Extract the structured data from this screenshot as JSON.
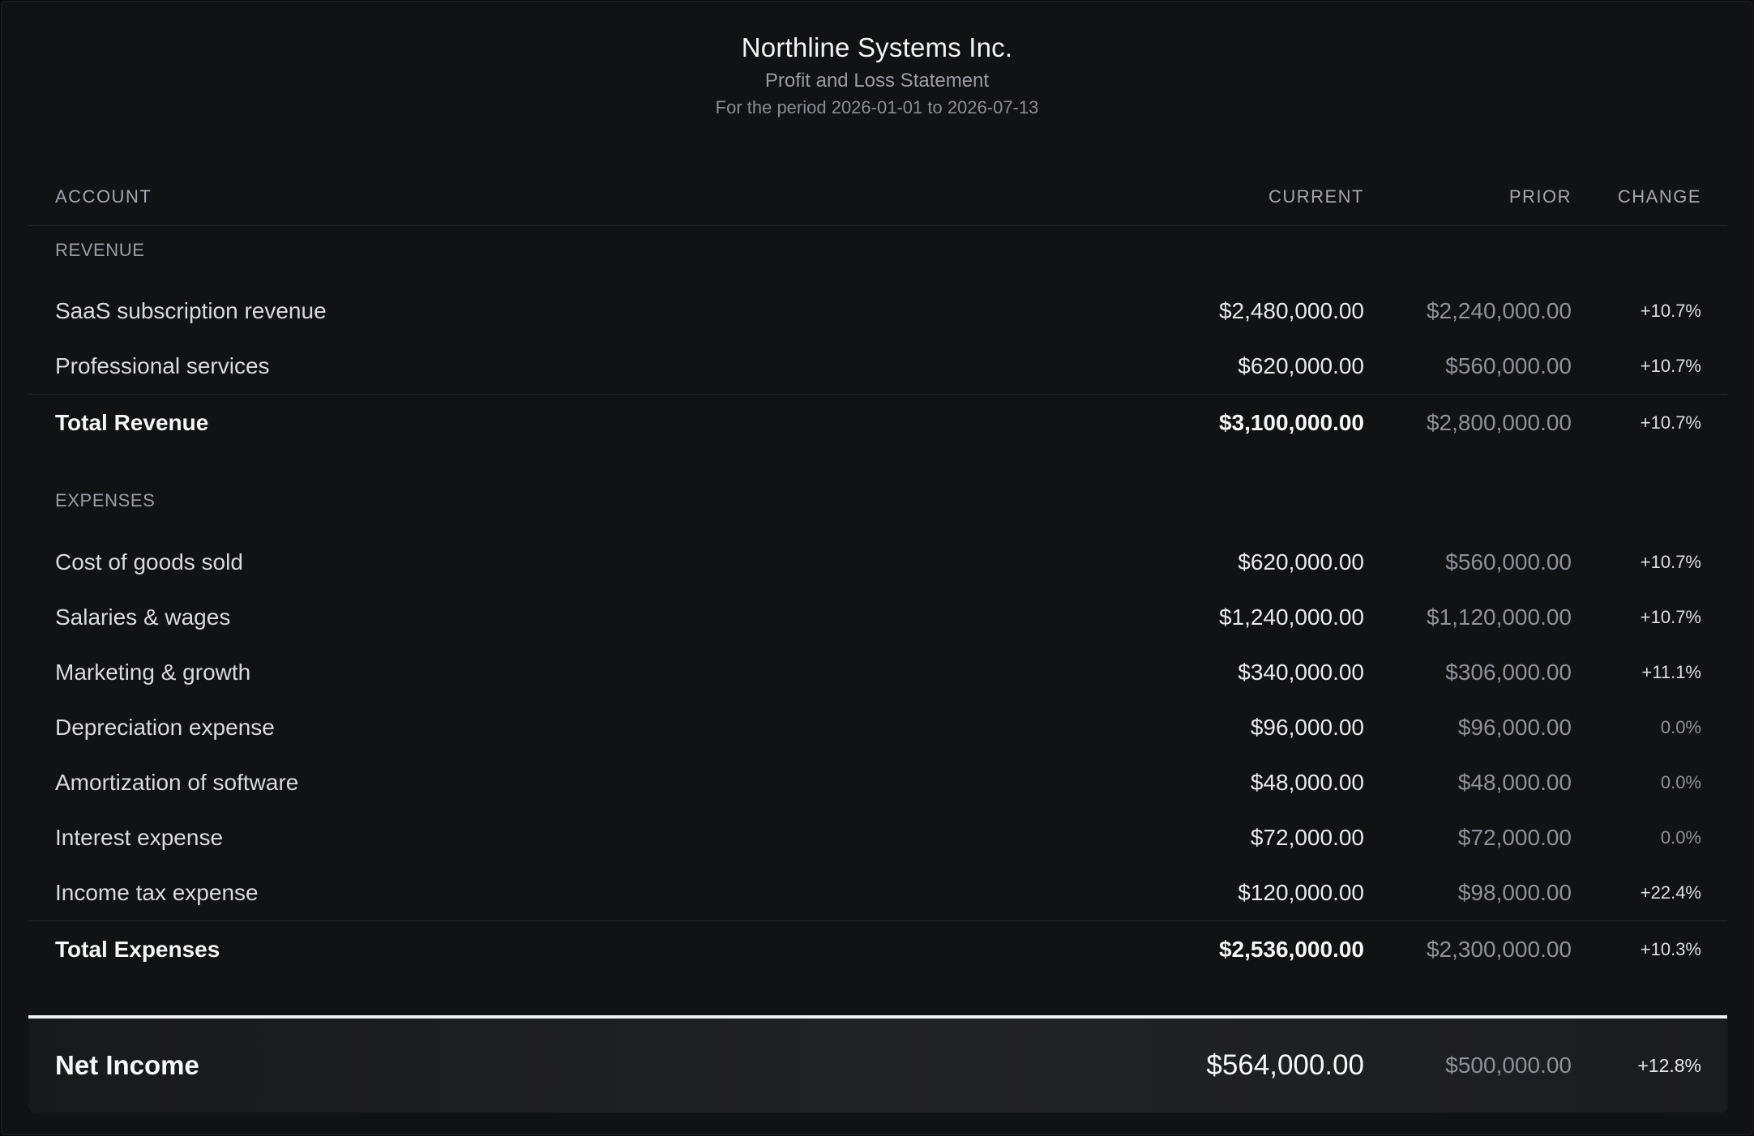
{
  "header": {
    "company": "Northline Systems Inc.",
    "statement": "Profit and Loss Statement",
    "period": "For the period 2026-01-01 to 2026-07-13"
  },
  "columns": {
    "account": "ACCOUNT",
    "current": "CURRENT",
    "prior": "PRIOR",
    "change": "CHANGE"
  },
  "revenue": {
    "label": "REVENUE",
    "items": [
      {
        "account": "SaaS subscription revenue",
        "current": "$2,480,000.00",
        "prior": "$2,240,000.00",
        "change": "+10.7%"
      },
      {
        "account": "Professional services",
        "current": "$620,000.00",
        "prior": "$560,000.00",
        "change": "+10.7%"
      }
    ],
    "total": {
      "account": "Total Revenue",
      "current": "$3,100,000.00",
      "prior": "$2,800,000.00",
      "change": "+10.7%"
    }
  },
  "expenses": {
    "label": "EXPENSES",
    "items": [
      {
        "account": "Cost of goods sold",
        "current": "$620,000.00",
        "prior": "$560,000.00",
        "change": "+10.7%"
      },
      {
        "account": "Salaries & wages",
        "current": "$1,240,000.00",
        "prior": "$1,120,000.00",
        "change": "+10.7%"
      },
      {
        "account": "Marketing & growth",
        "current": "$340,000.00",
        "prior": "$306,000.00",
        "change": "+11.1%"
      },
      {
        "account": "Depreciation expense",
        "current": "$96,000.00",
        "prior": "$96,000.00",
        "change": "0.0%"
      },
      {
        "account": "Amortization of software",
        "current": "$48,000.00",
        "prior": "$48,000.00",
        "change": "0.0%"
      },
      {
        "account": "Interest expense",
        "current": "$72,000.00",
        "prior": "$72,000.00",
        "change": "0.0%"
      },
      {
        "account": "Income tax expense",
        "current": "$120,000.00",
        "prior": "$98,000.00",
        "change": "+22.4%"
      }
    ],
    "total": {
      "account": "Total Expenses",
      "current": "$2,536,000.00",
      "prior": "$2,300,000.00",
      "change": "+10.3%"
    }
  },
  "net_income": {
    "account": "Net Income",
    "current": "$564,000.00",
    "prior": "$500,000.00",
    "change": "+12.8%"
  }
}
